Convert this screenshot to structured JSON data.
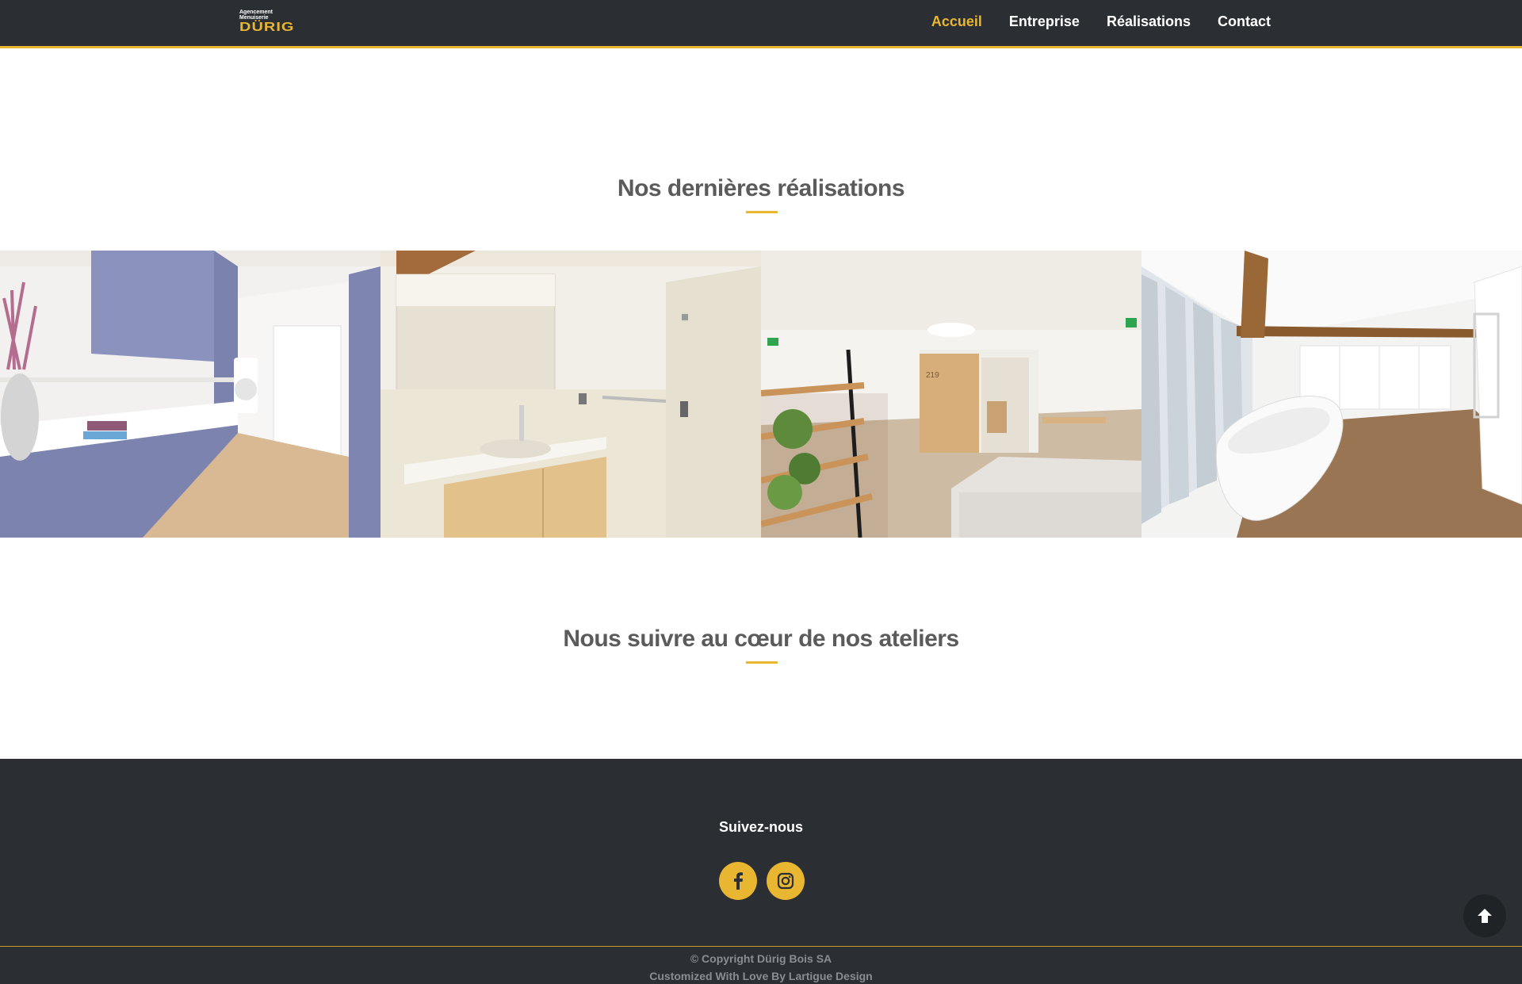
{
  "brand": {
    "line1": "Agencement",
    "line2": "Menuiserie",
    "name": "DÜRIG",
    "accent_color": "#e8b631",
    "header_color": "#2b2f33"
  },
  "nav": {
    "items": [
      {
        "label": "Accueil",
        "active": true
      },
      {
        "label": "Entreprise",
        "active": false
      },
      {
        "label": "Réalisations",
        "active": false
      },
      {
        "label": "Contact",
        "active": false
      }
    ]
  },
  "sections": {
    "realisations_title": "Nos dernières réalisations",
    "ateliers_title": "Nous suivre au cœur de nos ateliers"
  },
  "gallery": {
    "images": [
      {
        "subject": "blue kitchen cabinets with washing machine"
      },
      {
        "subject": "bathroom vanity with mirror"
      },
      {
        "subject": "hallway with wooden shelving and sofa"
      },
      {
        "subject": "attic room with freestanding bathtub"
      }
    ]
  },
  "footer": {
    "follow_label": "Suivez-nous",
    "social": [
      {
        "icon": "facebook-icon"
      },
      {
        "icon": "instagram-icon"
      }
    ],
    "copyright": "© Copyright Dürig Bois SA",
    "credit": "Customized With Love By Lartigue Design",
    "scroll_top_icon": "arrow-up-icon"
  }
}
